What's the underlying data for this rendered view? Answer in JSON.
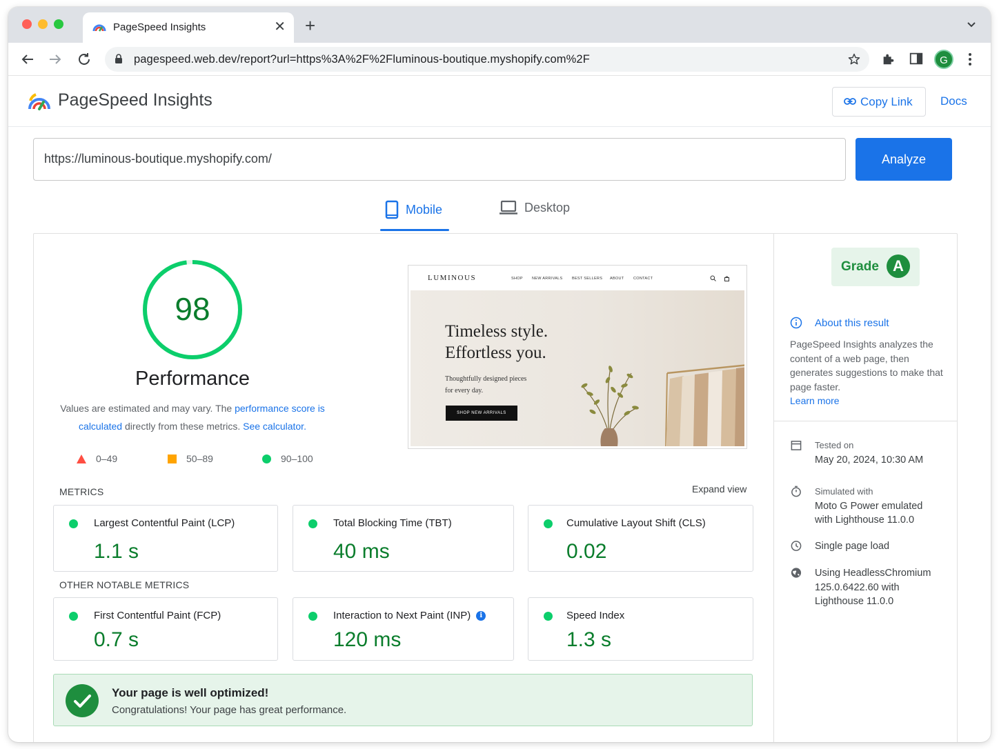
{
  "browser": {
    "tab_title": "PageSpeed Insights",
    "url": "pagespeed.web.dev/report?url=https%3A%2F%2Fluminous-boutique.myshopify.com%2F",
    "avatar_letter": "G"
  },
  "header": {
    "title": "PageSpeed Insights",
    "copy_link": "Copy Link",
    "docs": "Docs"
  },
  "search": {
    "url_value": "https://luminous-boutique.myshopify.com/",
    "analyze": "Analyze"
  },
  "device_tabs": {
    "mobile": "Mobile",
    "desktop": "Desktop",
    "selected": "Mobile"
  },
  "performance": {
    "score": "98",
    "score_value": 98,
    "label": "Performance",
    "note_1": "Values are estimated and may vary. The ",
    "note_link_1": "performance score is calculated",
    "note_2": " directly from these metrics. ",
    "note_link_2": "See calculator.",
    "legend": {
      "poor": "0–49",
      "average": "50–89",
      "good": "90–100"
    }
  },
  "screenshot": {
    "brand": "LUMINOUS",
    "menu": [
      "SHOP",
      "NEW ARRIVALS",
      "BEST SELLERS",
      "ABOUT",
      "CONTACT"
    ],
    "headline_1": "Timeless style.",
    "headline_2": "Effortless you.",
    "sub_1": "Thoughtfully designed pieces",
    "sub_2": "for every day.",
    "cta": "SHOP NEW ARRIVALS"
  },
  "metrics": {
    "label": "METRICS",
    "expand": "Expand view",
    "core": [
      {
        "name": "Largest Contentful Paint (LCP)",
        "value": "1.1 s"
      },
      {
        "name": "Total Blocking Time (TBT)",
        "value": "40 ms"
      },
      {
        "name": "Cumulative Layout Shift (CLS)",
        "value": "0.02"
      }
    ],
    "other_label": "OTHER NOTABLE METRICS",
    "other": [
      {
        "name": "First Contentful Paint (FCP)",
        "value": "0.7 s"
      },
      {
        "name": "Interaction to Next Paint (INP)",
        "value": "120 ms"
      },
      {
        "name": "Speed Index",
        "value": "1.3 s"
      }
    ]
  },
  "banner": {
    "title": "Your page is well optimized!",
    "subtitle": "Congratulations! Your page has great performance."
  },
  "sidebar": {
    "grade_label": "Grade",
    "grade": "A",
    "about_title": "About this result",
    "about_text": "PageSpeed Insights analyzes the content of a web page, then generates suggestions to make that page faster.",
    "learn_more": "Learn more",
    "tested_label": "Tested on",
    "tested_value": "May 20, 2024, 10:30 AM",
    "simulated_label": "Simulated with",
    "simulated_value": "Moto G Power emulated with Lighthouse 11.0.0",
    "load_type": "Single page load",
    "engine": "Using HeadlessChromium 125.0.6422.60 with Lighthouse 11.0.0"
  },
  "colors": {
    "accent": "#1a73e8",
    "good": "#0cce6b",
    "good_text": "#0a7d2c",
    "average": "#ffa400",
    "poor": "#ff4e42"
  }
}
